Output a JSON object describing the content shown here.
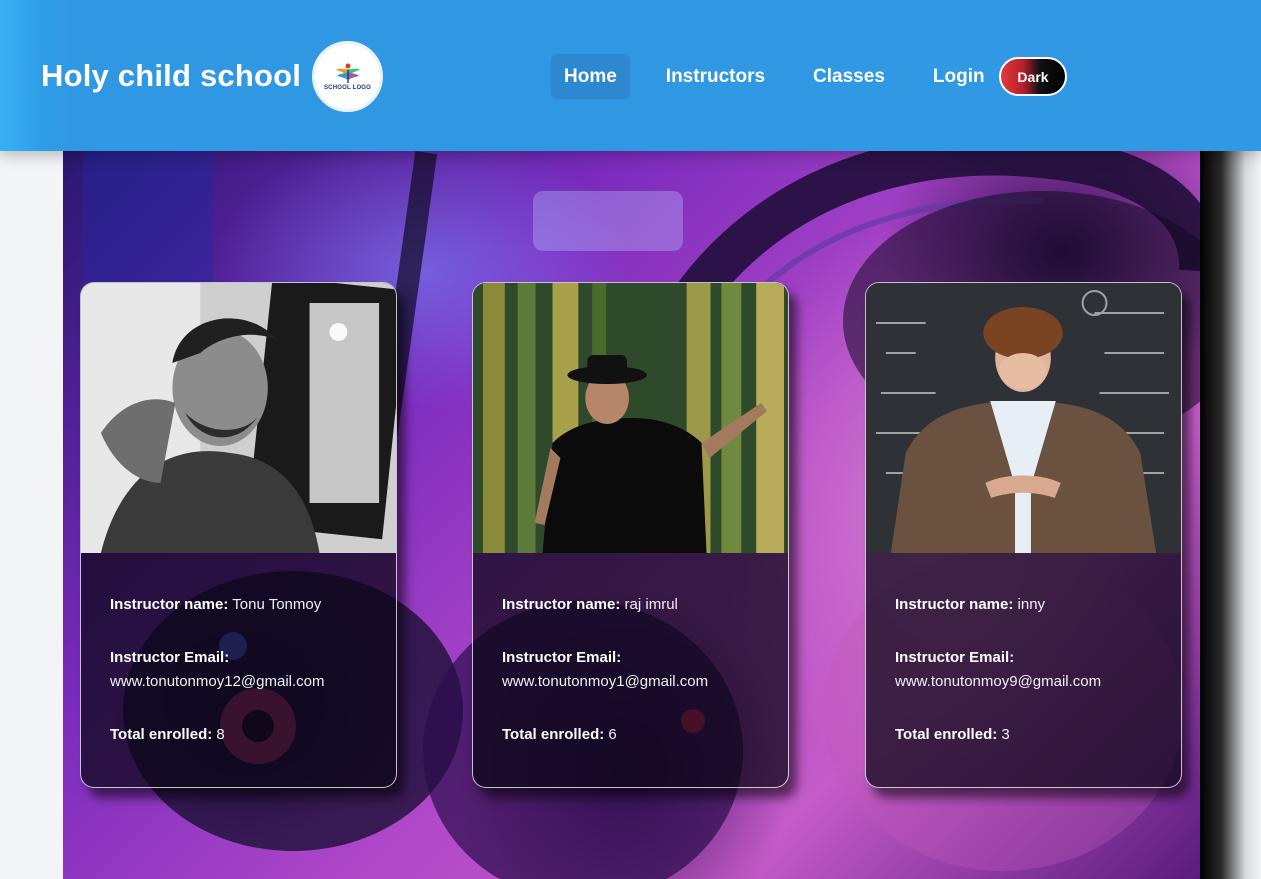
{
  "header": {
    "brand_title": "Holy child school",
    "logo": {
      "text": "SCHOOL LOGO",
      "icon": "school-logo-icon"
    },
    "nav": [
      {
        "label": "Home",
        "active": true
      },
      {
        "label": "Instructors",
        "active": false
      },
      {
        "label": "Classes",
        "active": false
      },
      {
        "label": "Login",
        "active": false
      }
    ],
    "theme_toggle_label": "Dark"
  },
  "colors": {
    "header_bg": "#3198e3",
    "nav_active_bg": "#2d88cf",
    "card_bg": "#080614"
  },
  "labels": {
    "name": "Instructor name:",
    "email": "Instructor Email:",
    "enrolled": "Total enrolled:"
  },
  "instructors": [
    {
      "name": "Tonu Tonmoy",
      "email": "www.tonutonmoy12@gmail.com",
      "enrolled": "8"
    },
    {
      "name": "raj imrul",
      "email": "www.tonutonmoy1@gmail.com",
      "enrolled": "6"
    },
    {
      "name": "inny",
      "email": "www.tonutonmoy9@gmail.com",
      "enrolled": "3"
    }
  ]
}
